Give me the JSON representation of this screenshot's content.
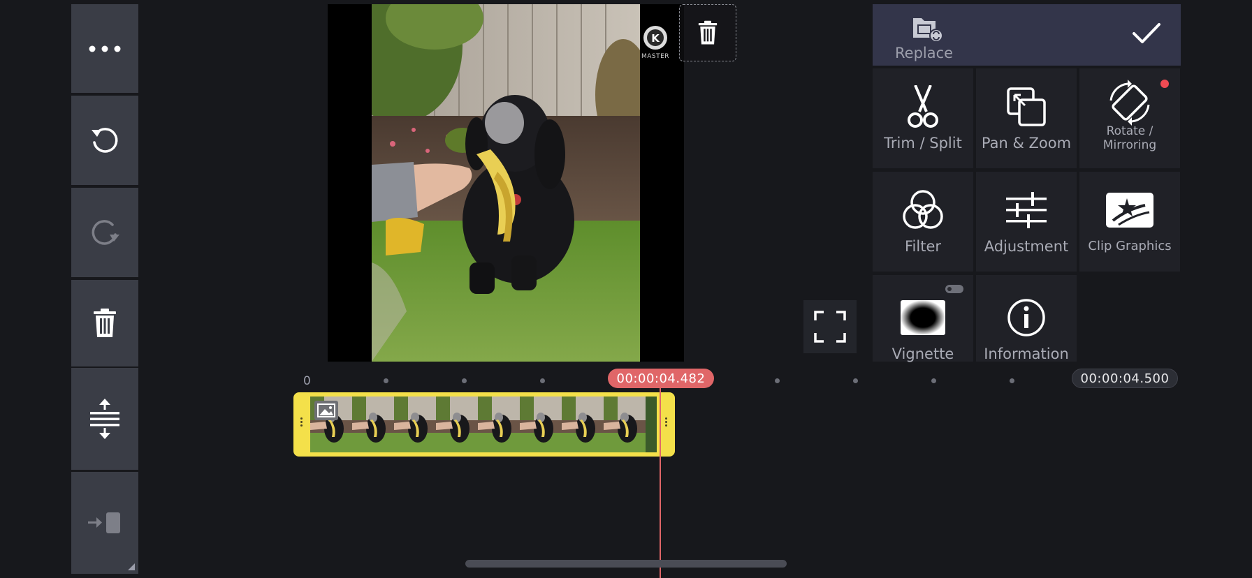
{
  "left_toolbar": {
    "items": [
      {
        "name": "more-options",
        "icon": "ellipsis-icon"
      },
      {
        "name": "undo",
        "icon": "undo-icon"
      },
      {
        "name": "redo",
        "icon": "redo-icon"
      },
      {
        "name": "delete",
        "icon": "trash-icon"
      },
      {
        "name": "expand-timeline",
        "icon": "expand-vertical-icon"
      },
      {
        "name": "go-to-clip-start",
        "icon": "arrow-to-clip-icon"
      }
    ]
  },
  "preview": {
    "watermark_text": "MASTER",
    "delete_icon": "trash-icon",
    "fullscreen_icon": "fullscreen-icon"
  },
  "panel": {
    "replace_label": "Replace",
    "confirm_icon": "check-icon",
    "tools": [
      {
        "label": "Trim / Split",
        "icon": "scissors-icon"
      },
      {
        "label": "Pan & Zoom",
        "icon": "pan-zoom-icon"
      },
      {
        "label": "Rotate /\nMirroring",
        "icon": "rotate-icon",
        "label_line1": "Rotate /",
        "label_line2": "Mirroring"
      },
      {
        "label": "Filter",
        "icon": "filter-icon"
      },
      {
        "label": "Adjustment",
        "icon": "sliders-icon"
      },
      {
        "label": "Clip Graphics",
        "icon": "clip-graphics-icon"
      },
      {
        "label": "Vignette",
        "icon": "vignette-icon"
      },
      {
        "label": "Information",
        "icon": "info-icon"
      }
    ]
  },
  "timeline": {
    "ruler_start": "0",
    "playhead_time": "00:00:04.482",
    "end_time": "00:00:04.500"
  },
  "colors": {
    "accent_red": "#e06668",
    "clip_yellow": "#f4e04a",
    "panel_bg": "#202127",
    "replace_bg": "#33354a"
  }
}
